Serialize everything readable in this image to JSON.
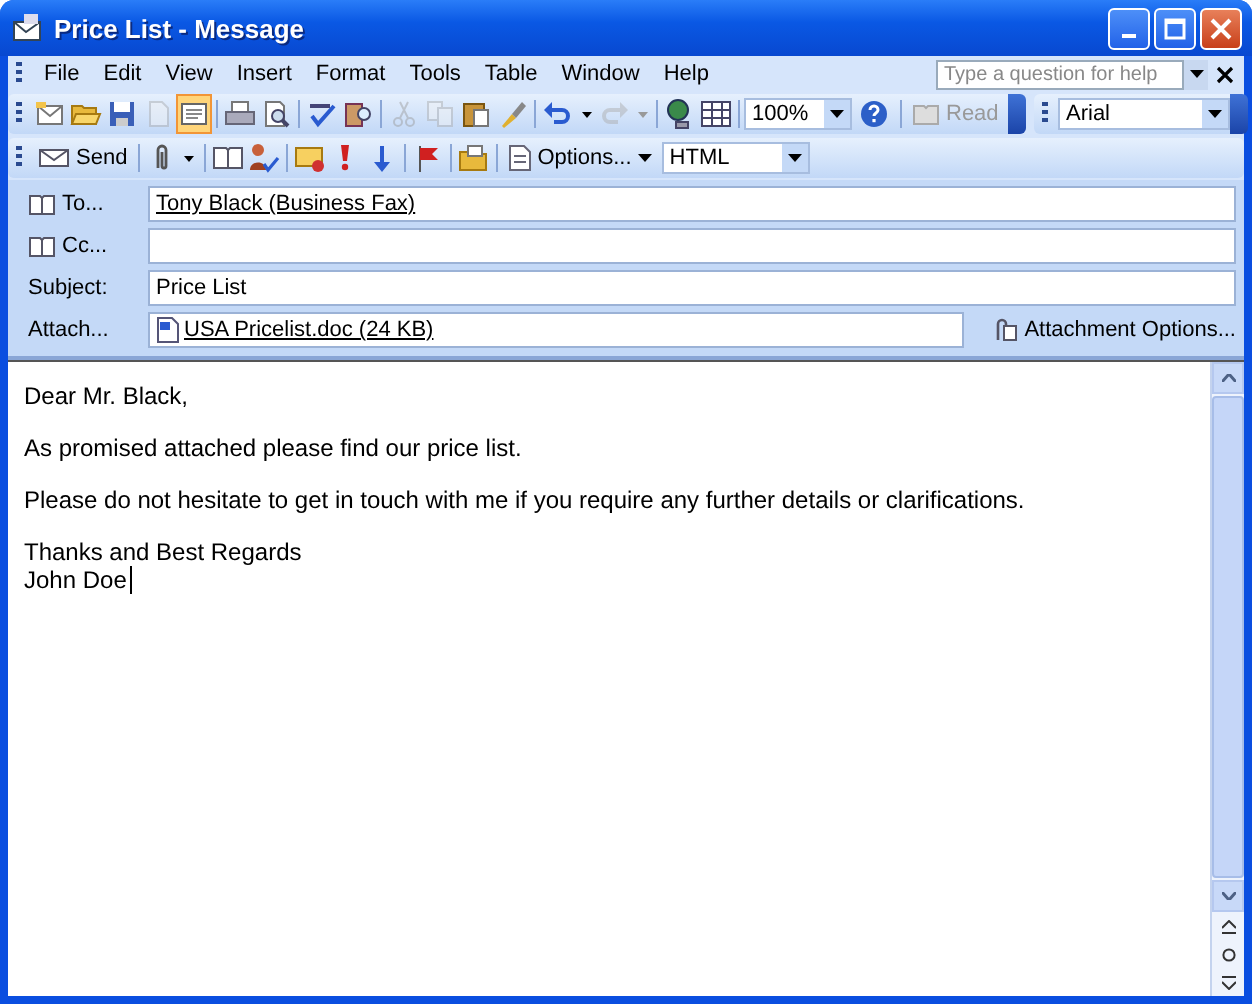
{
  "window": {
    "title": "Price List - Message"
  },
  "menu": [
    "File",
    "Edit",
    "View",
    "Insert",
    "Format",
    "Tools",
    "Table",
    "Window",
    "Help"
  ],
  "help_box": {
    "placeholder": "Type a question for help"
  },
  "standard_toolbar": [
    {
      "kind": "new",
      "pressed": false,
      "disabled": false
    },
    {
      "kind": "open",
      "pressed": false,
      "disabled": false
    },
    {
      "kind": "save",
      "pressed": false,
      "disabled": false
    },
    {
      "kind": "permission",
      "pressed": false,
      "disabled": true
    },
    {
      "kind": "envelope",
      "pressed": true,
      "disabled": false
    },
    {
      "kind": "sep"
    },
    {
      "kind": "print",
      "pressed": false,
      "disabled": false
    },
    {
      "kind": "preview",
      "pressed": false,
      "disabled": false
    },
    {
      "kind": "sep"
    },
    {
      "kind": "spelling",
      "pressed": false,
      "disabled": false
    },
    {
      "kind": "research",
      "pressed": false,
      "disabled": false
    },
    {
      "kind": "sep"
    },
    {
      "kind": "cut",
      "pressed": false,
      "disabled": true
    },
    {
      "kind": "copy",
      "pressed": false,
      "disabled": true
    },
    {
      "kind": "paste",
      "pressed": false,
      "disabled": false
    },
    {
      "kind": "brush",
      "pressed": false,
      "disabled": false
    },
    {
      "kind": "sep"
    },
    {
      "kind": "undo",
      "pressed": false,
      "disabled": false
    },
    {
      "kind": "redo",
      "pressed": false,
      "disabled": true
    },
    {
      "kind": "sep"
    },
    {
      "kind": "link",
      "pressed": false,
      "disabled": false
    },
    {
      "kind": "table",
      "pressed": false,
      "disabled": false
    }
  ],
  "zoom": "100%",
  "read": {
    "label": "Read",
    "disabled": true
  },
  "font": "Arial",
  "send_label": "Send",
  "options_label": "Options...",
  "format": "HTML",
  "headers": [
    {
      "kind": "address",
      "label": "To...",
      "value": "Tony Black (Business Fax)"
    },
    {
      "kind": "address",
      "label": "Cc..."
    },
    {
      "kind": "plain",
      "label": "Subject:",
      "value": "Price List"
    },
    {
      "kind": "attach",
      "label": "Attach...",
      "value": "USA Pricelist.doc (24 KB)"
    }
  ],
  "attachment_options": "Attachment Options...",
  "body": [
    [
      "Dear Mr. Black,"
    ],
    [
      "As promised attached please find our price list."
    ],
    [
      "Please do not hesitate to get in touch with me if you require any further details or clarifications."
    ],
    [
      "Thanks and Best Regards",
      "John Doe"
    ]
  ]
}
